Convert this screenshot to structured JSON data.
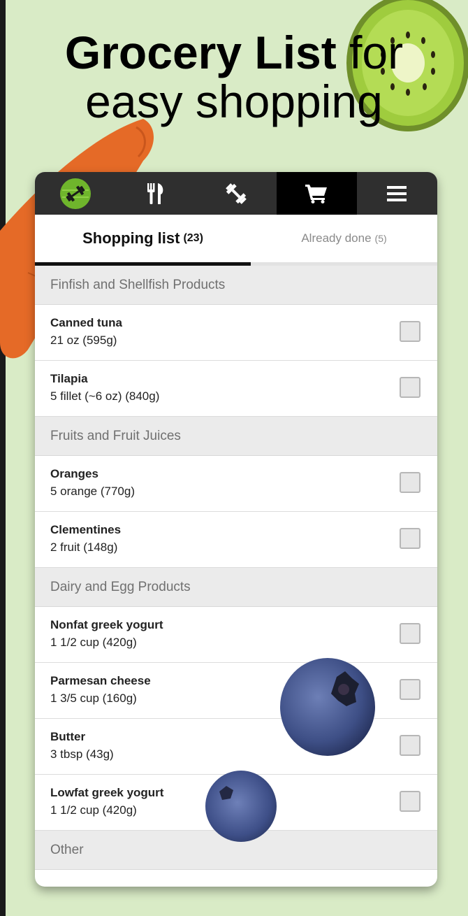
{
  "headline": {
    "bold": "Grocery List",
    "rest_line1": " for",
    "line2": "easy shopping"
  },
  "nav": {
    "items": [
      {
        "icon": "dumbbell-logo-icon",
        "active": false
      },
      {
        "icon": "fork-knife-icon",
        "active": false
      },
      {
        "icon": "dumbbell-icon",
        "active": false
      },
      {
        "icon": "shopping-cart-icon",
        "active": true
      },
      {
        "icon": "hamburger-menu-icon",
        "active": false
      }
    ]
  },
  "tabs": {
    "shopping_label": "Shopping list",
    "shopping_count": "(23)",
    "done_label": "Already done",
    "done_count": "(5)"
  },
  "sections": [
    {
      "title": "Finfish and Shellfish Products",
      "items": [
        {
          "name": "Canned tuna",
          "qty": "21 oz (595g)"
        },
        {
          "name": "Tilapia",
          "qty": "5 fillet (~6 oz) (840g)"
        }
      ]
    },
    {
      "title": "Fruits and Fruit Juices",
      "items": [
        {
          "name": "Oranges",
          "qty": "5 orange (770g)"
        },
        {
          "name": "Clementines",
          "qty": "2 fruit (148g)"
        }
      ]
    },
    {
      "title": "Dairy and Egg Products",
      "items": [
        {
          "name": "Nonfat greek yogurt",
          "qty": "1 1/2 cup (420g)"
        },
        {
          "name": "Parmesan cheese",
          "qty": "1 3/5 cup (160g)"
        },
        {
          "name": "Butter",
          "qty": "3 tbsp (43g)"
        },
        {
          "name": "Lowfat greek yogurt",
          "qty": "1 1/2 cup (420g)"
        }
      ]
    },
    {
      "title": "Other",
      "items": []
    }
  ],
  "colors": {
    "background": "#d9ebc6",
    "nav": "#2f2f2f",
    "nav_active": "#000000"
  }
}
